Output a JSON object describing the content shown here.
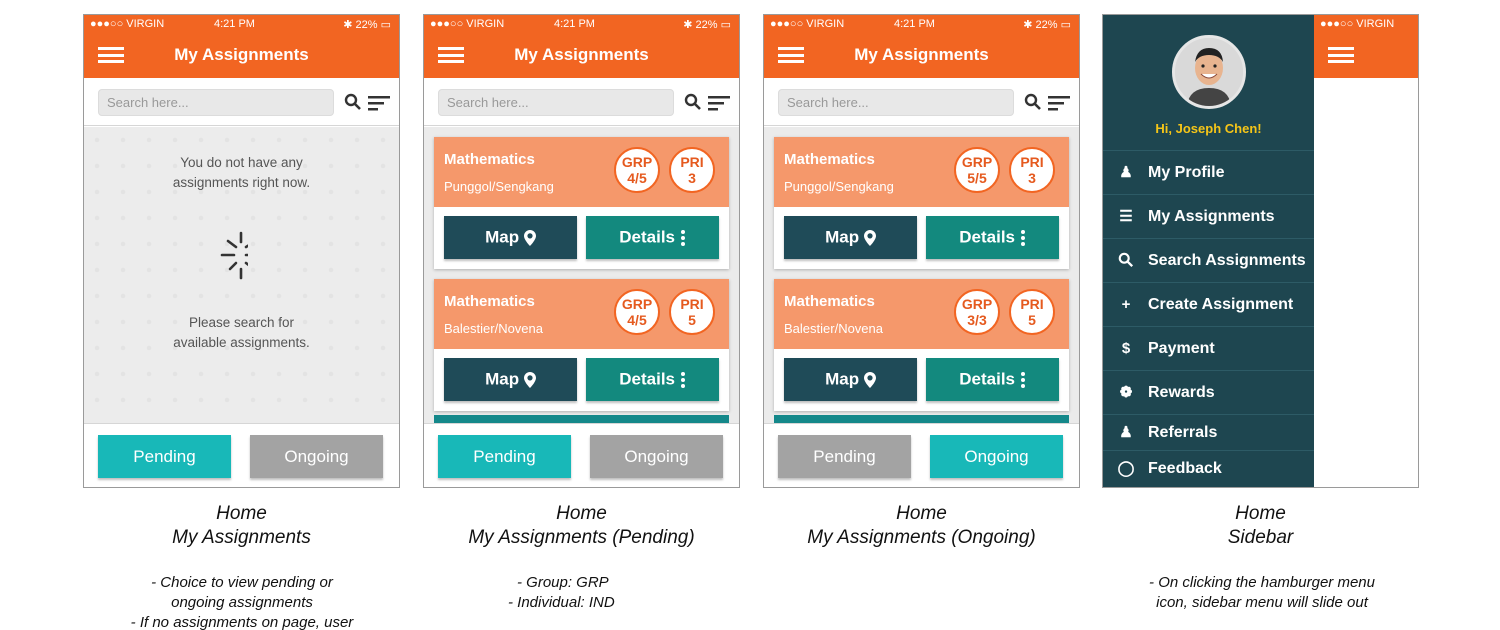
{
  "status": {
    "carrier": "●●●○○ VIRGIN",
    "time": "4:21 PM",
    "battery": "22%"
  },
  "screen_title": "My Assignments",
  "search_placeholder": "Search here...",
  "colors": {
    "brand": "#f26522",
    "card_header": "#f5986b",
    "map_button": "#1f4b58",
    "details_button": "#13897e",
    "tab_active": "#18b8b8",
    "tab_inactive": "#a3a3a3",
    "sidebar_bg": "#1e4650",
    "greeting": "#f5c518"
  },
  "empty_state": {
    "line1": "You do not have any",
    "line2": "assignments right now.",
    "line3": "Please search for",
    "line4": "available assignments."
  },
  "tabs": {
    "pending": "Pending",
    "ongoing": "Ongoing"
  },
  "buttons": {
    "map": "Map",
    "details": "Details"
  },
  "pending_cards": [
    {
      "subject": "Mathematics",
      "location": "Punggol/Sengkang",
      "grp_label": "GRP",
      "grp_value": "4/5",
      "pri_label": "PRI",
      "pri_value": "3"
    },
    {
      "subject": "Mathematics",
      "location": "Balestier/Novena",
      "grp_label": "GRP",
      "grp_value": "4/5",
      "pri_label": "PRI",
      "pri_value": "5"
    }
  ],
  "ongoing_cards": [
    {
      "subject": "Mathematics",
      "location": "Punggol/Sengkang",
      "grp_label": "GRP",
      "grp_value": "5/5",
      "pri_label": "PRI",
      "pri_value": "3"
    },
    {
      "subject": "Mathematics",
      "location": "Balestier/Novena",
      "grp_label": "GRP",
      "grp_value": "3/3",
      "pri_label": "PRI",
      "pri_value": "5"
    }
  ],
  "sidebar": {
    "greeting": "Hi, Joseph Chen!",
    "items": [
      {
        "label": "My Profile",
        "icon": "user-icon"
      },
      {
        "label": "My Assignments",
        "icon": "document-icon"
      },
      {
        "label": "Search Assignments",
        "icon": "search-icon"
      },
      {
        "label": "Create Assignment",
        "icon": "plus-icon"
      },
      {
        "label": "Payment",
        "icon": "dollar-icon"
      },
      {
        "label": "Rewards",
        "icon": "award-icon"
      },
      {
        "label": "Referrals",
        "icon": "referral-icon"
      },
      {
        "label": "Feedback",
        "icon": "chat-bubble-icon"
      }
    ]
  },
  "captions": {
    "c1": {
      "line1": "Home",
      "line2": "My Assignments"
    },
    "c2": {
      "line1": "Home",
      "line2": "My Assignments (Pending)"
    },
    "c3": {
      "line1": "Home",
      "line2": "My Assignments (Ongoing)"
    },
    "c4": {
      "line1": "Home",
      "line2": "Sidebar"
    }
  },
  "notes": {
    "n1a": "-  Choice to view pending or",
    "n1b": "ongoing assignments",
    "n1c": "-  If no assignments on page, user",
    "n2a": "-  Group: GRP",
    "n2b": "-  Individual: IND",
    "n4a": "-  On clicking the hamburger menu",
    "n4b": "icon, sidebar menu will slide out"
  }
}
